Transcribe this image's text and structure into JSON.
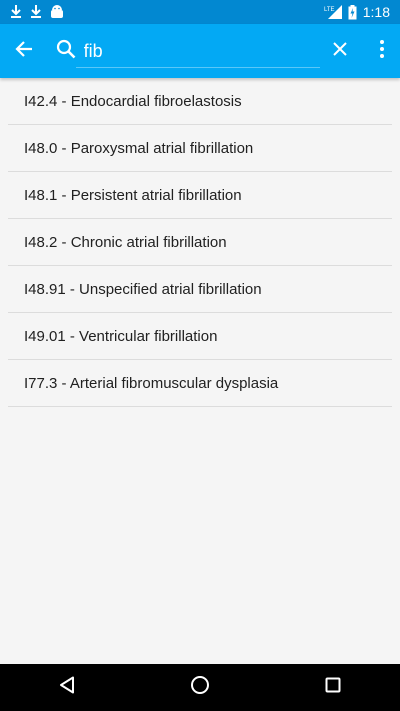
{
  "status_bar": {
    "time": "1:18",
    "network_label": "LTE",
    "left_icons": [
      "download-icon",
      "download-icon",
      "android-icon"
    ],
    "right_icons": [
      "signal-icon",
      "battery-charging-icon"
    ]
  },
  "app_bar": {
    "back_icon": "arrow-back-icon",
    "search_icon": "search-icon",
    "search_value": "fib",
    "clear_icon": "close-icon",
    "menu_icon": "more-vert-icon"
  },
  "results": [
    {
      "label": "I42.4 - Endocardial fibroelastosis"
    },
    {
      "label": "I48.0 - Paroxysmal atrial fibrillation"
    },
    {
      "label": "I48.1 - Persistent atrial fibrillation"
    },
    {
      "label": "I48.2 - Chronic atrial fibrillation"
    },
    {
      "label": "I48.91 - Unspecified atrial fibrillation"
    },
    {
      "label": "I49.01 - Ventricular fibrillation"
    },
    {
      "label": "I77.3 - Arterial fibromuscular dysplasia"
    }
  ],
  "nav_bar": {
    "buttons": [
      "back-triangle-icon",
      "home-circle-icon",
      "recents-square-icon"
    ]
  },
  "colors": {
    "status_bar": "#0288d1",
    "app_bar": "#03a9f4",
    "background": "#f5f5f5",
    "divider": "#dcdcdc",
    "text": "#212121"
  }
}
